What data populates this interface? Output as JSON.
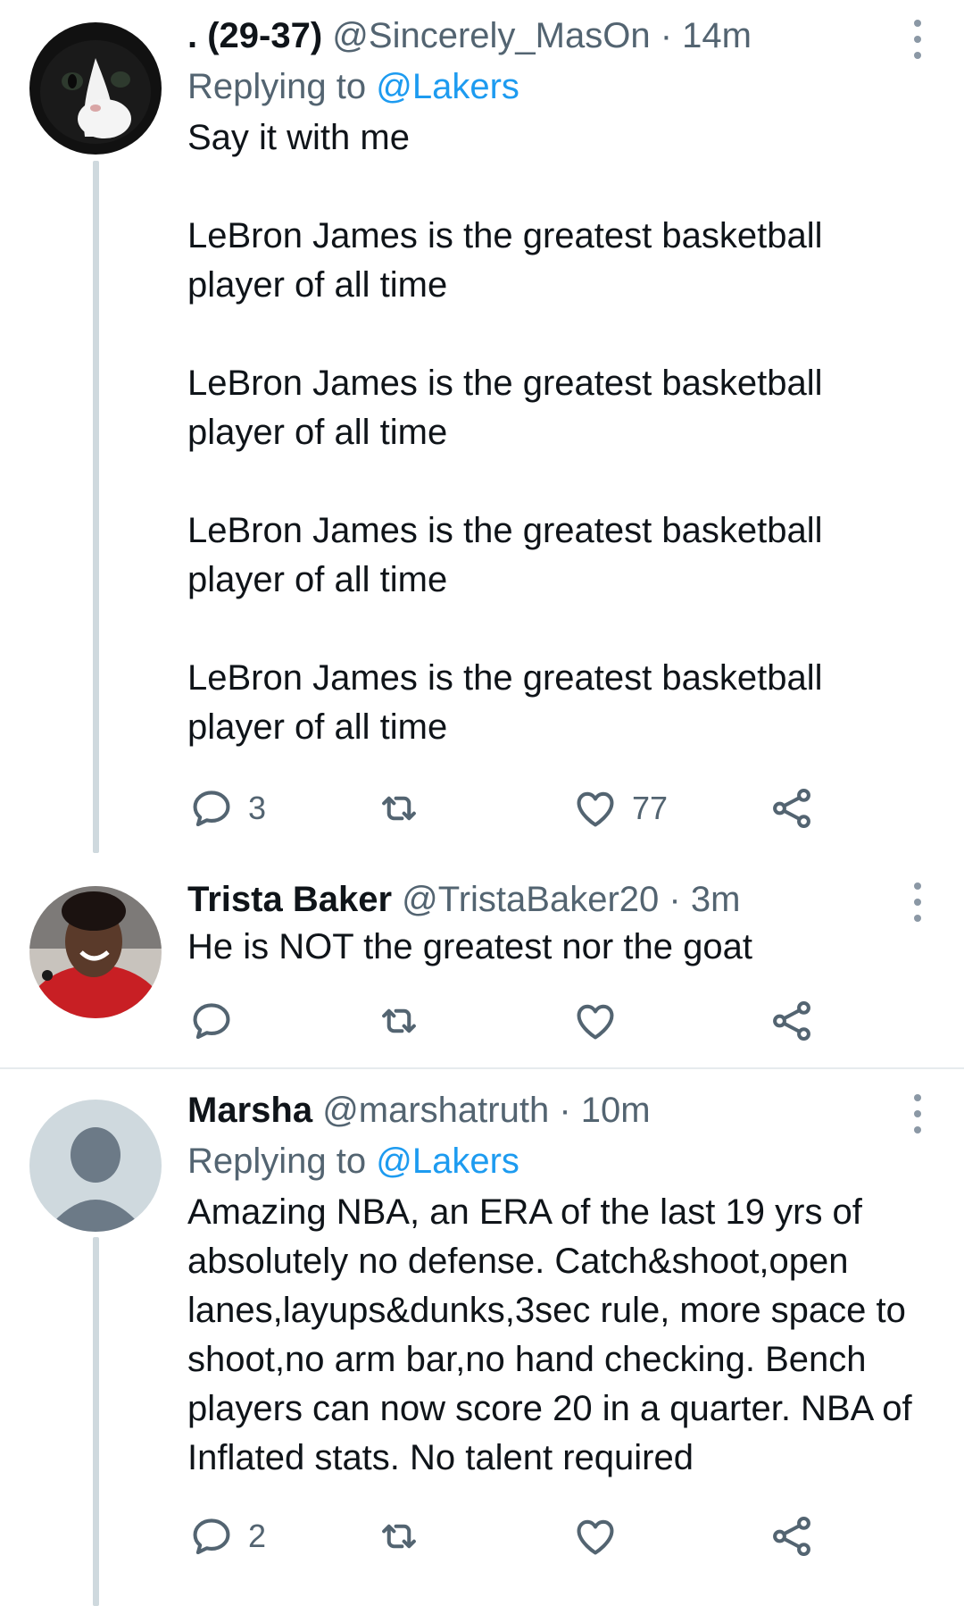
{
  "tweets": [
    {
      "display_name": ". (29-37)",
      "handle": "@Sincerely_MasOn",
      "time": "· 14m",
      "replying_prefix": "Replying to ",
      "replying_to": "@Lakers",
      "text": "Say it with me\n\nLeBron James is the greatest basketball player of all time\n\nLeBron James is the greatest basketball player of all time\n\nLeBron James is the greatest basketball player of all time\n\nLeBron James is the greatest basketball player of all time",
      "reply_count": "3",
      "retweet_count": "",
      "like_count": "77",
      "avatar": "black-and-white-cat"
    },
    {
      "display_name": "Trista Baker",
      "handle": "@TristaBaker20",
      "time": "· 3m",
      "text": "He is NOT the greatest nor the goat",
      "reply_count": "",
      "retweet_count": "",
      "like_count": "",
      "avatar": "woman-red-shirt"
    },
    {
      "display_name": "Marsha",
      "handle": "@marshatruth",
      "time": "· 10m",
      "replying_prefix": "Replying to ",
      "replying_to": "@Lakers",
      "text": "Amazing NBA, an ERA of the last 19 yrs of absolutely no defense. Catch&shoot,open lanes,layups&dunks,3sec rule, more space to shoot,no arm bar,no hand checking. Bench players can now score 20 in a quarter. NBA of Inflated stats. No talent required",
      "reply_count": "2",
      "retweet_count": "",
      "like_count": "",
      "avatar": "default-person"
    }
  ],
  "colors": {
    "link": "#1d9bf0",
    "secondary_text": "#536471",
    "primary_text": "#0f1419",
    "thread_line": "#cfd9de",
    "icon": "#536471"
  },
  "icons": [
    "reply-icon",
    "retweet-icon",
    "like-icon",
    "share-icon",
    "more-icon"
  ]
}
